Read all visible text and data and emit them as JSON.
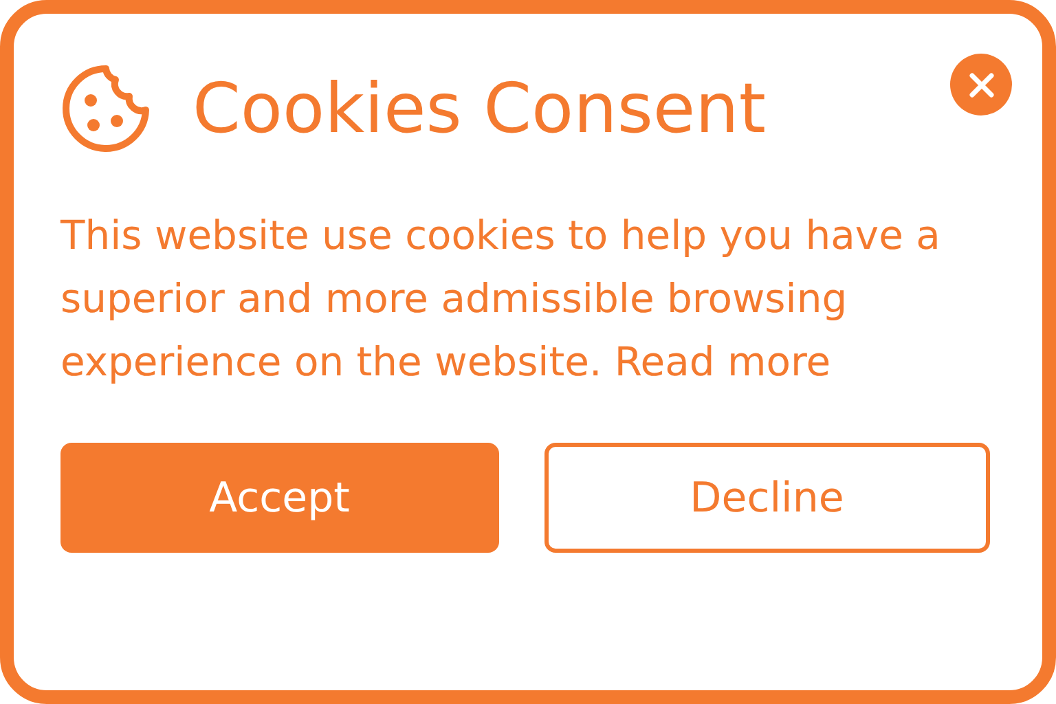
{
  "dialog": {
    "title": "Cookies Consent",
    "message": "This website use cookies to help you have a superior and more admissible browsing experience on the website.",
    "link": "Read more",
    "buttons": [
      {
        "label": "Accept",
        "kind": "primary"
      },
      {
        "label": "Decline",
        "kind": "secondary"
      }
    ]
  }
}
